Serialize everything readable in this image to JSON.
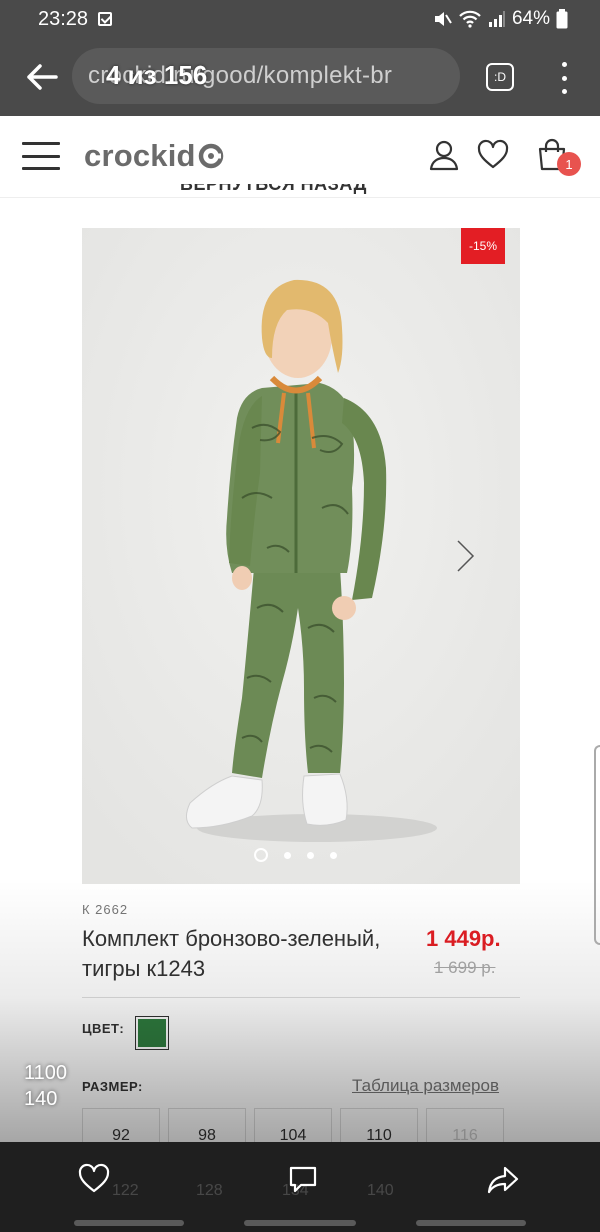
{
  "status_bar": {
    "time": "23:28",
    "battery": "64%"
  },
  "browser": {
    "url": "crockid.ru/good/komplekt-br",
    "gallery_counter": "4 из 156",
    "tabs_label": ":D"
  },
  "header": {
    "logo": "crockid",
    "cart_count": "1"
  },
  "back_link": "ВЕРНУТЬСЯ НАЗАД",
  "product": {
    "discount": "-15%",
    "sku": "К 2662",
    "name": "Комплект бронзово-зеленый, тигры к1243",
    "price_now": "1 449р.",
    "price_old": "1 699 р.",
    "color_label": "ЦВЕТ:",
    "color_hex": "#2f7d3f",
    "size_label": "РАЗМЕР:",
    "size_table_link": "Таблица размеров",
    "sizes": [
      "92",
      "98",
      "104",
      "110",
      "116"
    ],
    "gallery_dots": 4
  },
  "overlay": {
    "line1": "1100",
    "line2": "140"
  },
  "bottom_bar": {
    "faint_sizes": [
      "122",
      "128",
      "134",
      "140"
    ]
  }
}
